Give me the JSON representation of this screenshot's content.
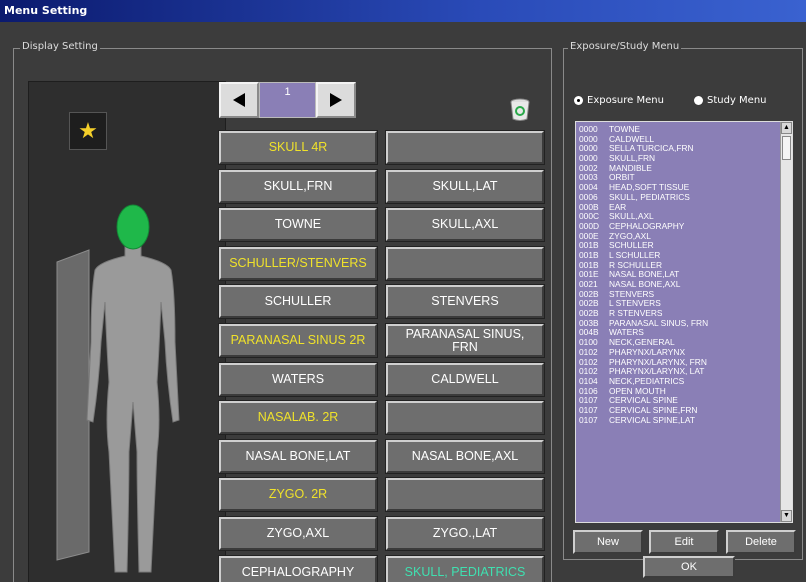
{
  "window": {
    "title": "Menu Setting"
  },
  "display_setting": {
    "title": "Display Setting",
    "page_number": "1",
    "buttons": [
      {
        "label": "SKULL 4R",
        "color": "yellow"
      },
      {
        "label": "",
        "color": "white"
      },
      {
        "label": "SKULL,FRN",
        "color": "white"
      },
      {
        "label": "SKULL,LAT",
        "color": "white"
      },
      {
        "label": "TOWNE",
        "color": "white"
      },
      {
        "label": "SKULL,AXL",
        "color": "white"
      },
      {
        "label": "SCHULLER/STENVERS",
        "color": "yellow"
      },
      {
        "label": "",
        "color": "white"
      },
      {
        "label": "SCHULLER",
        "color": "white"
      },
      {
        "label": "STENVERS",
        "color": "white"
      },
      {
        "label": "PARANASAL SINUS 2R",
        "color": "yellow"
      },
      {
        "label": "PARANASAL SINUS, FRN",
        "color": "white"
      },
      {
        "label": "WATERS",
        "color": "white"
      },
      {
        "label": "CALDWELL",
        "color": "white"
      },
      {
        "label": "NASALAB. 2R",
        "color": "yellow"
      },
      {
        "label": "",
        "color": "white"
      },
      {
        "label": "NASAL BONE,LAT",
        "color": "white"
      },
      {
        "label": "NASAL BONE,AXL",
        "color": "white"
      },
      {
        "label": "ZYGO. 2R",
        "color": "yellow"
      },
      {
        "label": "",
        "color": "white"
      },
      {
        "label": "ZYGO,AXL",
        "color": "white"
      },
      {
        "label": "ZYGO.,LAT",
        "color": "white"
      },
      {
        "label": "CEPHALOGRAPHY",
        "color": "white"
      },
      {
        "label": "SKULL, PEDIATRICS",
        "color": "green"
      }
    ]
  },
  "exposure_menu": {
    "title": "Exposure/Study Menu",
    "radio_exposure": "Exposure Menu",
    "radio_study": "Study Menu",
    "items": [
      {
        "code": "0000",
        "name": "TOWNE"
      },
      {
        "code": "0000",
        "name": "CALDWELL"
      },
      {
        "code": "0000",
        "name": "SELLA TURCICA,FRN"
      },
      {
        "code": "0000",
        "name": "SKULL,FRN"
      },
      {
        "code": "0002",
        "name": "MANDIBLE"
      },
      {
        "code": "0003",
        "name": "ORBIT"
      },
      {
        "code": "0004",
        "name": "HEAD,SOFT TISSUE"
      },
      {
        "code": "0006",
        "name": "SKULL, PEDIATRICS"
      },
      {
        "code": "000B",
        "name": "EAR"
      },
      {
        "code": "000C",
        "name": "SKULL,AXL"
      },
      {
        "code": "000D",
        "name": "CEPHALOGRAPHY"
      },
      {
        "code": "000E",
        "name": "ZYGO,AXL"
      },
      {
        "code": "001B",
        "name": "SCHULLER"
      },
      {
        "code": "001B",
        "name": "L SCHULLER"
      },
      {
        "code": "001B",
        "name": "R SCHULLER"
      },
      {
        "code": "001E",
        "name": "NASAL BONE,LAT"
      },
      {
        "code": "0021",
        "name": "NASAL BONE,AXL"
      },
      {
        "code": "002B",
        "name": "STENVERS"
      },
      {
        "code": "002B",
        "name": "L STENVERS"
      },
      {
        "code": "002B",
        "name": "R STENVERS"
      },
      {
        "code": "003B",
        "name": "PARANASAL SINUS, FRN"
      },
      {
        "code": "004B",
        "name": "WATERS"
      },
      {
        "code": "0100",
        "name": "NECK,GENERAL"
      },
      {
        "code": "0102",
        "name": "PHARYNX/LARYNX"
      },
      {
        "code": "0102",
        "name": "PHARYNX/LARYNX, FRN"
      },
      {
        "code": "0102",
        "name": "PHARYNX/LARYNX, LAT"
      },
      {
        "code": "0104",
        "name": "NECK,PEDIATRICS"
      },
      {
        "code": "0106",
        "name": "OPEN MOUTH"
      },
      {
        "code": "0107",
        "name": "CERVICAL SPINE"
      },
      {
        "code": "0107",
        "name": "CERVICAL SPINE,FRN"
      },
      {
        "code": "0107",
        "name": "CERVICAL SPINE,LAT"
      }
    ],
    "new_label": "New",
    "edit_label": "Edit",
    "delete_label": "Delete"
  },
  "ok_label": "OK",
  "colors": {
    "list_bg": "#8a7fb6",
    "yellow": "#f0e22a",
    "green": "#3fe0b0",
    "head": "#1fb84a"
  }
}
